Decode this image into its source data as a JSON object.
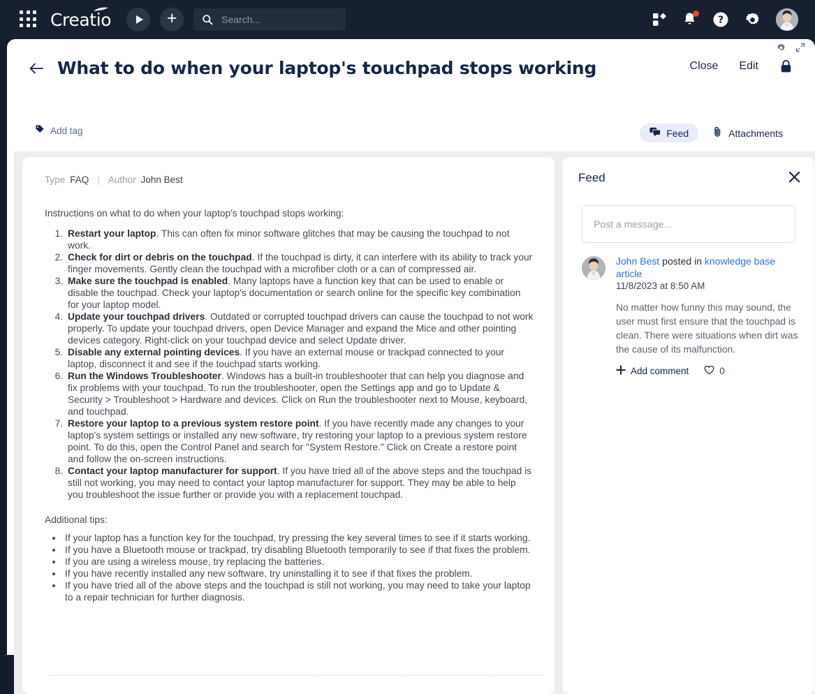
{
  "topbar": {
    "brand": "Creatio",
    "apps_icon": "apps-grid-icon",
    "run_icon": "run-process-icon",
    "add_icon": "add-icon",
    "search": {
      "placeholder": "Search...",
      "value": "",
      "icon": "search-icon"
    },
    "right_icons": [
      {
        "name": "marketplace-icon",
        "label": "Marketplace"
      },
      {
        "name": "notifications-bell-icon",
        "label": "Notifications",
        "badge": true
      },
      {
        "name": "help-question-icon",
        "label": "Help"
      },
      {
        "name": "settings-gear-icon",
        "label": "Settings"
      },
      {
        "name": "user-avatar",
        "label": "User profile"
      }
    ]
  },
  "card": {
    "tools": [
      {
        "name": "card-settings-gear-icon"
      },
      {
        "name": "expand-fullscreen-icon"
      }
    ],
    "back_icon": "back-arrow-icon",
    "title": "What to do when your laptop's touchpad stops working",
    "actions": {
      "close_label": "Close",
      "edit_label": "Edit",
      "lock_icon": "lock-icon"
    },
    "tag": {
      "icon": "tag-icon",
      "label": "Add tag"
    },
    "tabs": [
      {
        "name": "tab-feed",
        "label": "Feed",
        "icon": "feed-chat-icon",
        "active": true
      },
      {
        "name": "tab-attachments",
        "label": "Attachments",
        "icon": "paperclip-icon",
        "active": false
      }
    ]
  },
  "article": {
    "meta": {
      "type_key": "Type",
      "type_value": "FAQ",
      "author_key": "Author",
      "author_value": "John Best"
    },
    "intro": "Instructions on what to do when your laptop's touchpad stops working:",
    "steps": [
      {
        "lead": "Restart your laptop",
        "text": ". This can often fix minor software glitches that may be causing the touchpad to not work."
      },
      {
        "lead": "Check for dirt or debris on the touchpad",
        "text": ". If the touchpad is dirty, it can interfere with its ability to track your finger movements. Gently clean the touchpad with a microfiber cloth or a can of compressed air."
      },
      {
        "lead": "Make sure the touchpad is enabled",
        "text": ". Many laptops have a function key that can be used to enable or disable the touchpad. Check your laptop's documentation or search online for the specific key combination for your laptop model."
      },
      {
        "lead": "Update your touchpad drivers",
        "text": ". Outdated or corrupted touchpad drivers can cause the touchpad to not work properly. To update your touchpad drivers, open Device Manager and expand the Mice and other pointing devices category. Right-click on your touchpad device and select Update driver."
      },
      {
        "lead": "Disable any external pointing devices",
        "text": ". If you have an external mouse or trackpad connected to your laptop, disconnect it and see if the touchpad starts working."
      },
      {
        "lead": "Run the Windows Troubleshooter",
        "text": ". Windows has a built-in troubleshooter that can help you diagnose and fix problems with your touchpad. To run the troubleshooter, open the Settings app and go to Update & Security > Troubleshoot > Hardware and devices. Click on Run the troubleshooter next to Mouse, keyboard, and touchpad."
      },
      {
        "lead": "Restore your laptop to a previous system restore point",
        "text": ". If you have recently made any changes to your laptop's system settings or installed any new software, try restoring your laptop to a previous system restore point. To do this, open the Control Panel and search for \"System Restore.\" Click on Create a restore point and follow the on-screen instructions."
      },
      {
        "lead": "Contact your laptop manufacturer for support",
        "text": ". If you have tried all of the above steps and the touchpad is still not working, you may need to contact your laptop manufacturer for support. They may be able to help you troubleshoot the issue further or provide you with a replacement touchpad."
      }
    ],
    "tips_heading": "Additional tips:",
    "tips": [
      "If your laptop has a function key for the touchpad, try pressing the key several times to see if it starts working.",
      "If you have a Bluetooth mouse or trackpad, try disabling Bluetooth temporarily to see if that fixes the problem.",
      "If you are using a wireless mouse, try replacing the batteries.",
      "If you have recently installed any new software, try uninstalling it to see if that fixes the problem.",
      "If you have tried all of the above steps and the touchpad is still not working, you may need to take your laptop to a repair technician for further diagnosis."
    ]
  },
  "feed": {
    "title": "Feed",
    "close_icon": "close-icon",
    "composer": {
      "placeholder": "Post a message...",
      "value": ""
    },
    "post": {
      "author": "John Best",
      "posted_in_text": " posted in",
      "target": "knowledge base article",
      "timestamp": "11/8/2023 at 8:50 AM",
      "body": "No matter how funny this may sound, the user must first ensure that the touchpad is clean. There were situations when dirt was the cause of its malfunction.",
      "add_comment_label": "Add comment",
      "like_count": "0"
    }
  },
  "colors": {
    "topbar_bg": "#16202e",
    "accent_blue": "#2f6fe4",
    "title_navy": "#16264a",
    "tab_active_bg": "#e9ecfb",
    "badge_red": "#f0432e",
    "panel_bg": "#eceef0"
  }
}
